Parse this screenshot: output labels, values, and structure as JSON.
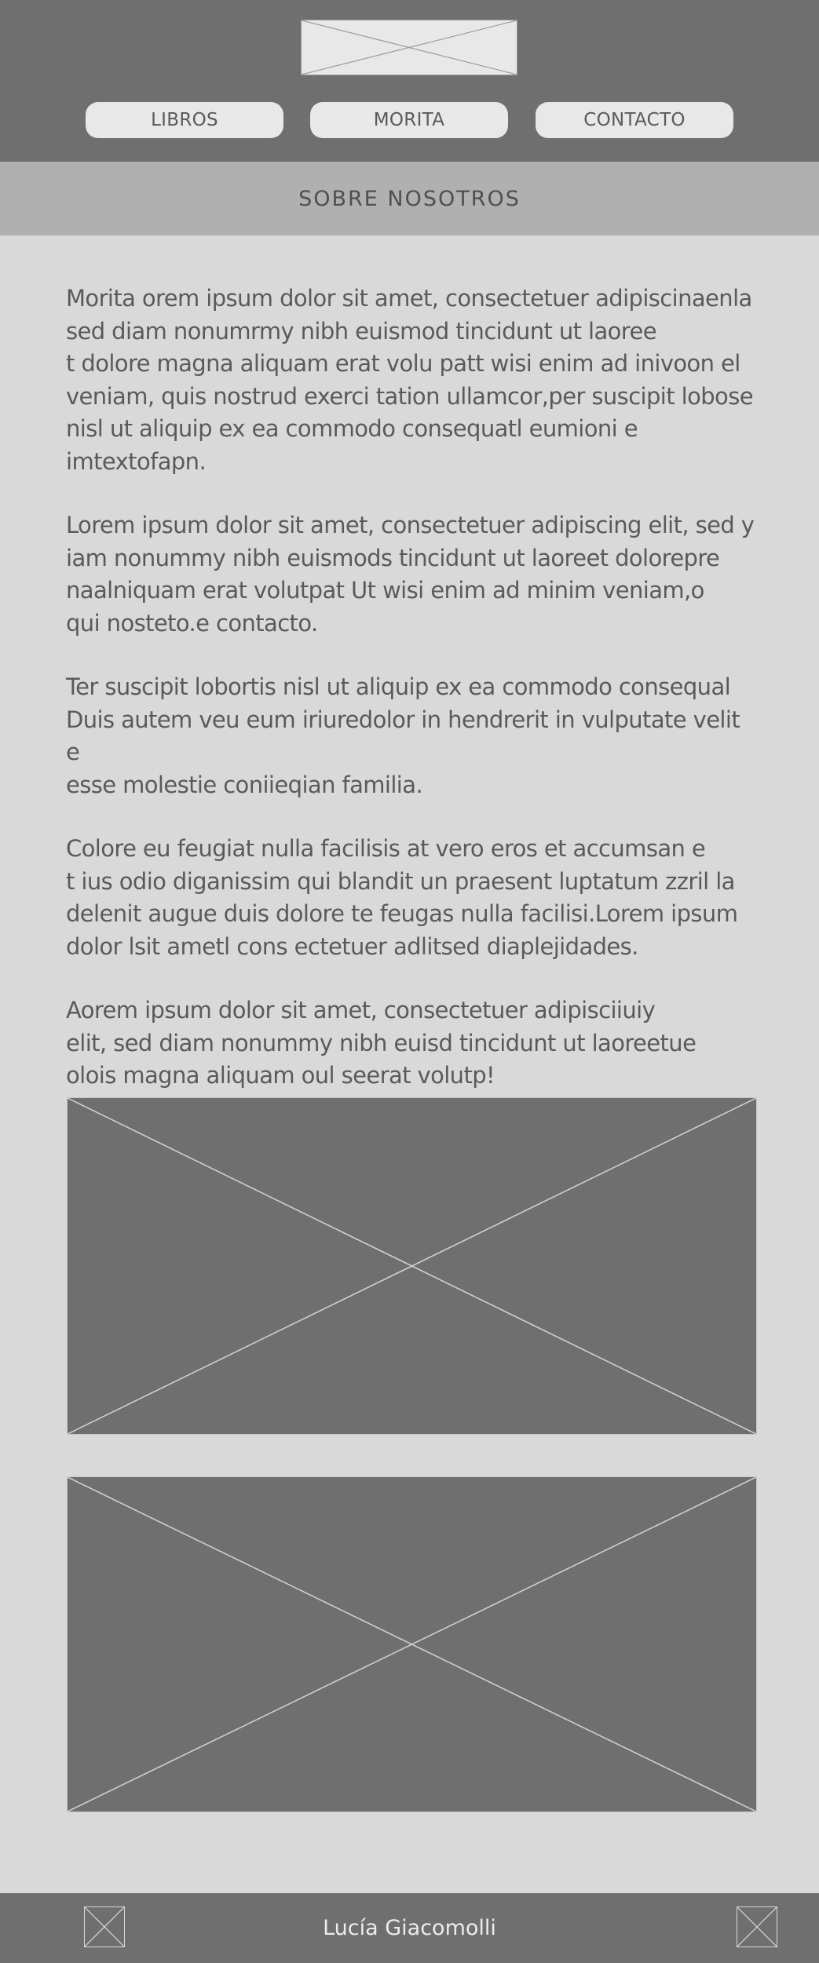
{
  "header": {
    "logo": "logo-placeholder",
    "nav": [
      {
        "label": "LIBROS"
      },
      {
        "label": "MORITA"
      },
      {
        "label": "CONTACTO"
      }
    ]
  },
  "section": {
    "title": "SOBRE NOSOTROS"
  },
  "content": {
    "paragraphs": [
      "Morita orem ipsum dolor sit amet, consectetuer adipiscinaenla\nsed diam nonumrmy nibh euismod tincidunt ut laoree\nt dolore magna aliquam erat volu patt wisi enim ad inivoon el\nveniam, quis nostrud exerci tation ullamcor,per suscipit lobose\nnisl ut aliquip ex ea commodo consequatl eumioni e\nimtextofapn.",
      "Lorem ipsum dolor sit amet, consectetuer adipiscing elit, sed y\niam nonummy nibh euismods tincidunt ut laoreet dolorepre\nnaalniquam erat volutpat Ut wisi enim ad minim veniam,o\nqui nosteto.e contacto.",
      "Ter suscipit lobortis nisl ut aliquip ex ea commodo consequal\nDuis autem veu eum iriuredolor in hendrerit in vulputate velit e\nesse molestie coniieqian familia.",
      "Colore eu feugiat nulla facilisis at vero eros et accumsan e\nt ius odio diganissim qui blandit  un praesent luptatum zzril la\ndelenit augue duis dolore te feugas nulla facilisi.Lorem ipsum\ndolor lsit ametl cons ectetuer adlitsed diaplejidades.",
      "Aorem ipsum dolor sit amet, consectetuer adipisciiuiy\nelit, sed diam nonummy nibh euisd tincidunt ut laoreetue\nolois magna aliquam oul seerat volutp!"
    ],
    "images": [
      "image-placeholder",
      "image-placeholder"
    ]
  },
  "footer": {
    "name": "Lucía Giacomolli",
    "left_icon": "image-placeholder-icon",
    "right_icon": "image-placeholder-icon"
  },
  "colors": {
    "header_bg": "#6f6f6f",
    "band_bg": "#b0b0b0",
    "page_bg": "#d9d9d9",
    "button_bg": "#e8e8e8",
    "text": "#5a5a5a"
  }
}
